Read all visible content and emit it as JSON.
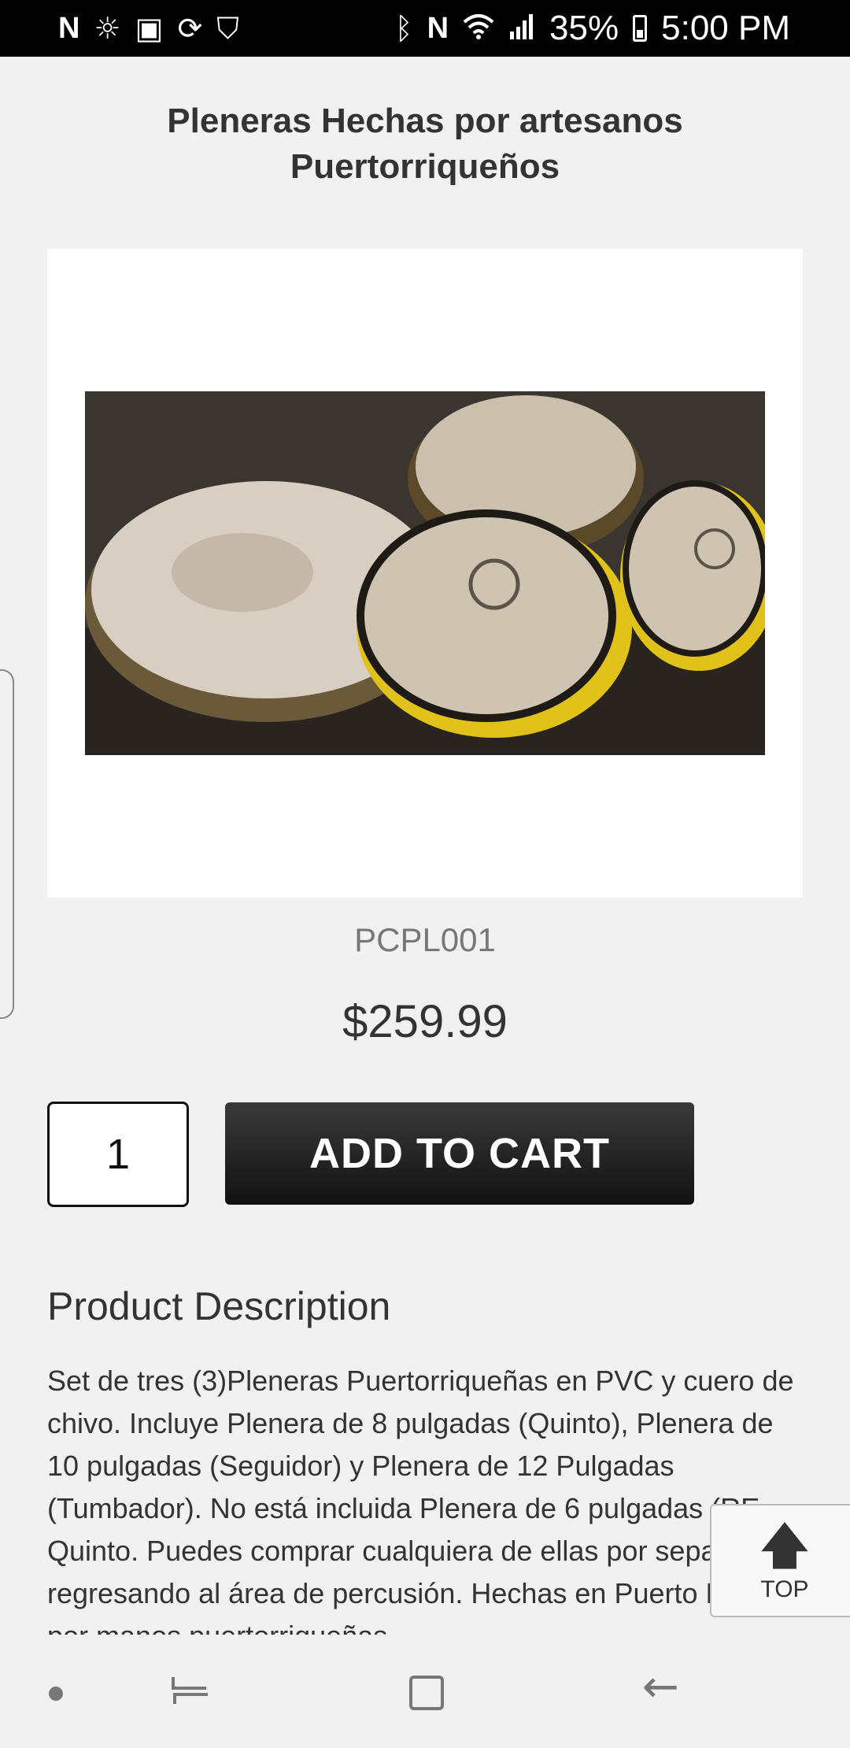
{
  "status_bar": {
    "icons_left": [
      "netflix-icon",
      "weather-icon",
      "screenshot-icon",
      "sync-icon",
      "shield-icon"
    ],
    "icons_right": [
      "bluetooth-icon",
      "nfc-icon",
      "wifi-icon",
      "signal-icon"
    ],
    "battery": "35%",
    "time": "5:00 PM"
  },
  "page": {
    "title": "Pleneras Hechas por artesanos Puertorriqueños"
  },
  "product": {
    "image_alt": "Pleneras",
    "sku": "PCPL001",
    "price": "$259.99",
    "quantity": "1",
    "add_to_cart_label": "ADD TO CART"
  },
  "description": {
    "heading": "Product Description",
    "text": "Set de tres (3)Pleneras Puertorriqueñas en PVC y cuero de chivo. Incluye Plenera de 8 pulgadas (Quinto), Plenera de 10 pulgadas (Seguidor) y Plenera de 12 Pulgadas (Tumbador). No está incluida Plenera de 6 pulgadas (RE-Quinto. Puedes comprar cualquiera de ellas por separado regresando al área de percusión. Hechas en Puerto Rico por manos puertorriqueñas"
  },
  "top_button": {
    "label": "TOP"
  },
  "colors": {
    "background": "#f1f1f1",
    "button_dark": "#1a1a1a",
    "drum_yellow": "#e0c21a"
  }
}
